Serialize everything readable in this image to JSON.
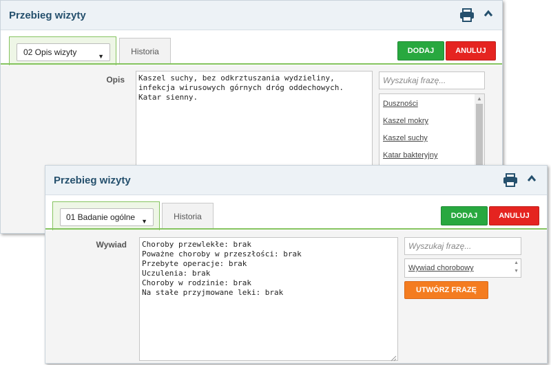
{
  "back_panel": {
    "title": "Przebieg wizyty",
    "select_value": "02 Opis wizyty",
    "tab_history": "Historia",
    "add_label": "DODAJ",
    "cancel_label": "ANULUJ",
    "field_label": "Opis",
    "text": "Kaszel suchy, bez odkrztuszania wydzieliny,\ninfekcja wirusowych górnych dróg oddechowych.\nKatar sienny.",
    "search_placeholder": "Wyszukaj frazę...",
    "phrases": [
      "Duszności",
      "Kaszel mokry",
      "Kaszel suchy",
      "Katar bakteryjny"
    ]
  },
  "front_panel": {
    "title": "Przebieg wizyty",
    "select_value": "01 Badanie ogólne",
    "tab_history": "Historia",
    "add_label": "DODAJ",
    "cancel_label": "ANULUJ",
    "field_label": "Wywiad",
    "text": "Choroby przewlekłe: brak\nPoważne choroby w przeszłości: brak\nPrzebyte operacje: brak\nUczulenia: brak\nChoroby w rodzinie: brak\nNa stałe przyjmowane leki: brak",
    "search_placeholder": "Wyszukaj frazę...",
    "phrases": [
      "Wywiad chorobowy"
    ],
    "create_phrase_label": "UTWÓRZ FRAZĘ"
  },
  "icons": {
    "print": "print-icon",
    "collapse": "chevron-up-icon",
    "resize": "resize-grip-icon"
  },
  "colors": {
    "title": "#25506d",
    "green": "#28a83f",
    "red": "#e52420",
    "orange": "#f47c20",
    "accent_line": "#84c35e"
  }
}
